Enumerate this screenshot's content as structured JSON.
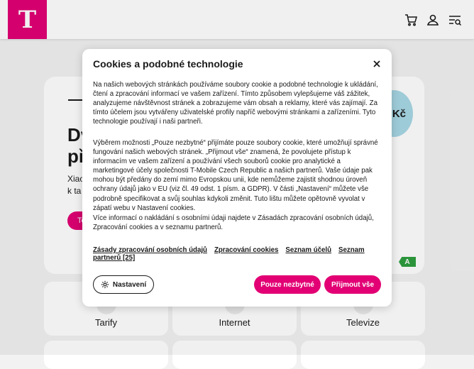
{
  "header": {
    "logo_text": "T",
    "brand_color": "#e20074",
    "icons": [
      "cart-icon",
      "user-icon",
      "menu-search-icon"
    ]
  },
  "hero": {
    "title": "Dv\npř",
    "text": "Xiao\nk ta",
    "button_label": "To",
    "price_suffix": "Kč",
    "energy_label": "A"
  },
  "tiles": [
    {
      "label": "Tarify"
    },
    {
      "label": "Internet"
    },
    {
      "label": "Televize"
    }
  ],
  "cookie_modal": {
    "title": "Cookies a podobné technologie",
    "paragraph1": "Na našich webových stránkách používáme soubory cookie a podobné technologie k ukládání, čtení a zpracování informací ve vašem zařízení. Tímto způsobem vylepšujeme váš zážitek, analyzujeme návštěvnost stránek a zobrazujeme vám obsah a reklamy, které vás zajímají. Za tímto účelem jsou vytvářeny uživatelské profily napříč webovými stránkami a zařízeními. Tyto technologie používají i naši partneři.",
    "paragraph2": "Výběrem možnosti „Pouze nezbytné“ přijímáte pouze soubory cookie, které umožňují správné fungování našich webových stránek. „Přijmout vše“ znamená, že povolujete přístup k informacím ve vašem zařízení a používání všech souborů cookie pro analytické a marketingové účely společnosti T-Mobile Czech Republic a našich partnerů. Vaše údaje pak mohou být předány do zemí mimo Evropskou unii, kde nemůžeme zajistit shodnou úroveň ochrany údajů jako v EU (viz čl. 49 odst. 1 písm. a GDPR). V části „Nastavení“ můžete vše podrobně specifikovat a svůj souhlas kdykoli změnit. Tuto lištu můžete opětovně vyvolat v zápatí webu v Nastavení cookies.",
    "paragraph3": "Více informací o nakládání s osobními údaji najdete v Zásadách zpracování osobních údajů, Zpracování cookies a v seznamu partnerů.",
    "links": [
      "Zásady zpracování osobních údajů",
      "Zpracování cookies",
      "Seznam účelů",
      "Seznam partnerů [25]"
    ],
    "settings_label": "Nastavení",
    "necessary_label": "Pouze nezbytné",
    "accept_all_label": "Přijmout vše"
  }
}
